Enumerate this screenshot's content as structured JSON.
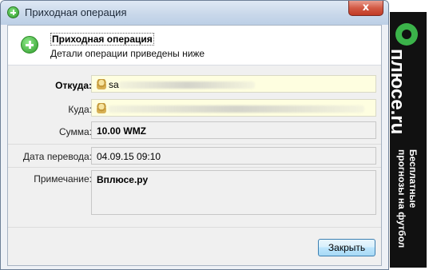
{
  "window": {
    "title": "Приходная операция",
    "close_glyph": "x"
  },
  "header": {
    "title": "Приходная операция",
    "subtitle": "Детали операции приведены ниже"
  },
  "fields": {
    "from_label": "Откуда:",
    "from_value": "sa",
    "to_label": "Куда:",
    "to_value": "",
    "sum_label": "Сумма:",
    "sum_value": "10.00 WMZ",
    "date_label": "Дата перевода:",
    "date_value": "04.09.15 09:10",
    "memo_label": "Примечание:",
    "memo_value": "Вплюсе.ру"
  },
  "buttons": {
    "close_label": "Закрыть"
  },
  "banner": {
    "logo_text": "плюсе.ru",
    "tagline": "Бесплатные\nпрогнозы на футбол",
    "brand_color": "#3bb34a"
  },
  "icons": [
    "plus-circle-icon",
    "purse-icon"
  ]
}
